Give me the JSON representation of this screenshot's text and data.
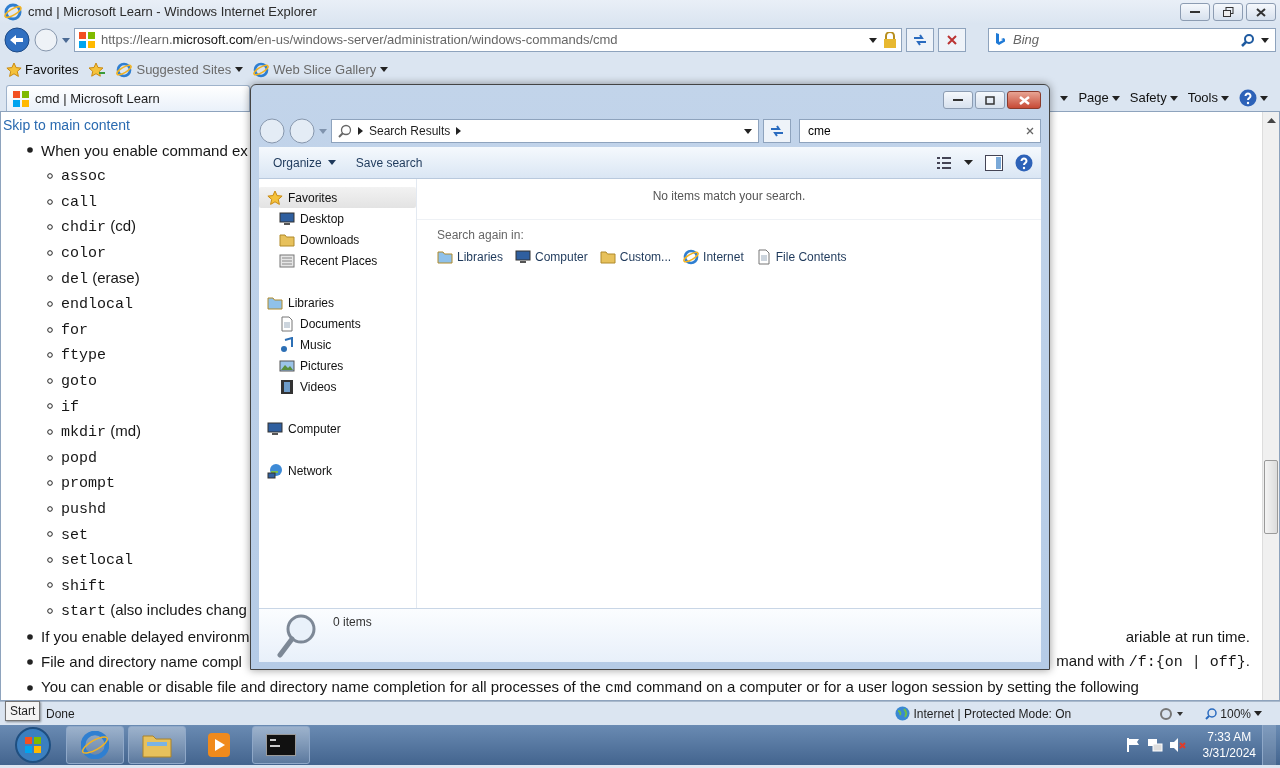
{
  "window": {
    "title": "cmd | Microsoft Learn - Windows Internet Explorer"
  },
  "address_bar": {
    "url": "https://learn.**microsoft.com**/en-us/windows-server/administration/windows-commands/cmd"
  },
  "search": {
    "placeholder": "Bing"
  },
  "favorites_bar": {
    "label": "Favorites",
    "items": [
      "Suggested Sites",
      "Web Slice Gallery"
    ]
  },
  "tabs": [
    {
      "title": "cmd | Microsoft Learn",
      "selected": true
    }
  ],
  "command_bar": [
    "Page",
    "Safety",
    "Tools"
  ],
  "page": {
    "skip_link": "Skip to main content",
    "intro": "When you enable command ex",
    "commands": [
      {
        "code": "assoc"
      },
      {
        "code": "call"
      },
      {
        "code": "chdir",
        "note": "(cd)"
      },
      {
        "code": "color"
      },
      {
        "code": "del",
        "note": "(erase)"
      },
      {
        "code": "endlocal"
      },
      {
        "code": "for"
      },
      {
        "code": "ftype"
      },
      {
        "code": "goto"
      },
      {
        "code": "if"
      },
      {
        "code": "mkdir",
        "note": "(md)"
      },
      {
        "code": "popd"
      },
      {
        "code": "prompt"
      },
      {
        "code": "pushd"
      },
      {
        "code": "set"
      },
      {
        "code": "setlocal"
      },
      {
        "code": "shift"
      },
      {
        "code": "start",
        "note": "(also includes chang"
      }
    ],
    "bullets": [
      {
        "parts": [
          {
            "kind": "text",
            "text": "If you enable delayed environm"
          }
        ],
        "tail": [
          {
            "kind": "text",
            "text": "ariable at run time."
          }
        ]
      },
      {
        "parts": [
          {
            "kind": "text",
            "text": "File and directory name compl"
          }
        ],
        "tail": [
          {
            "kind": "text",
            "text": "mand with "
          },
          {
            "kind": "code",
            "text": "/f:{on | off}"
          },
          {
            "kind": "text",
            "text": "."
          }
        ]
      },
      {
        "parts": [
          {
            "kind": "text",
            "text": "You can enable or disable file and directory name completion for all processes of the "
          },
          {
            "kind": "code",
            "text": "cmd"
          },
          {
            "kind": "text",
            "text": " command on a computer or for a user logon session by setting the following"
          }
        ]
      }
    ]
  },
  "status_bar": {
    "text": "Done",
    "zone": "Internet | Protected Mode: On",
    "zoom": "100%"
  },
  "tooltip": "Start",
  "clock": {
    "time": "7:33 AM",
    "date": "3/31/2024"
  },
  "explorer": {
    "location": "Search Results",
    "search_value": "cme",
    "toolbar": [
      "Organize",
      "Save search"
    ],
    "sidebar": [
      {
        "label": "Favorites",
        "selected": true,
        "children": [
          {
            "label": "Desktop",
            "selected": false
          },
          {
            "label": "Downloads",
            "selected": false
          },
          {
            "label": "Recent Places",
            "selected": false
          }
        ]
      },
      {
        "label": "Libraries",
        "selected": false,
        "children": [
          {
            "label": "Documents",
            "selected": false
          },
          {
            "label": "Music",
            "selected": false
          },
          {
            "label": "Pictures",
            "selected": false
          },
          {
            "label": "Videos",
            "selected": false
          }
        ]
      },
      {
        "label": "Computer",
        "selected": false
      },
      {
        "label": "Network",
        "selected": false
      }
    ],
    "message": "No items match your search.",
    "search_again_label": "Search again in:",
    "search_again": [
      "Libraries",
      "Computer",
      "Custom...",
      "Internet",
      "File Contents"
    ],
    "item_count": "0 items"
  }
}
